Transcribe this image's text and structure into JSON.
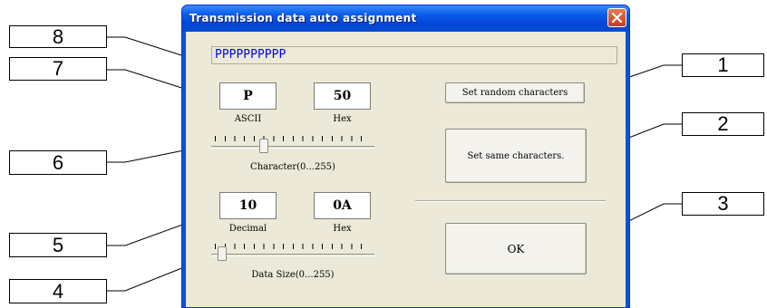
{
  "window": {
    "title": "Transmission data auto assignment",
    "close_icon": "close-icon"
  },
  "data_field": {
    "value": "PPPPPPPPPP"
  },
  "character": {
    "ascii_value": "P",
    "hex_value": "50",
    "ascii_caption": "ASCII",
    "hex_caption": "Hex",
    "slider_caption": "Character(0...255)",
    "slider_value": 80,
    "slider_max": 255
  },
  "data_size": {
    "decimal_value": "10",
    "hex_value": "0A",
    "decimal_caption": "Decimal",
    "hex_caption": "Hex",
    "slider_caption": "Data Size(0...255)",
    "slider_value": 10,
    "slider_max": 255
  },
  "buttons": {
    "random": "Set random characters",
    "same": "Set same characters.",
    "ok": "OK"
  },
  "callouts": [
    "1",
    "2",
    "3",
    "4",
    "5",
    "6",
    "7",
    "8"
  ],
  "colors": {
    "title_bar": "#0b5bea",
    "client_bg": "#ece9d8",
    "field_text": "#0000ff",
    "close_button": "#c63c1a"
  }
}
